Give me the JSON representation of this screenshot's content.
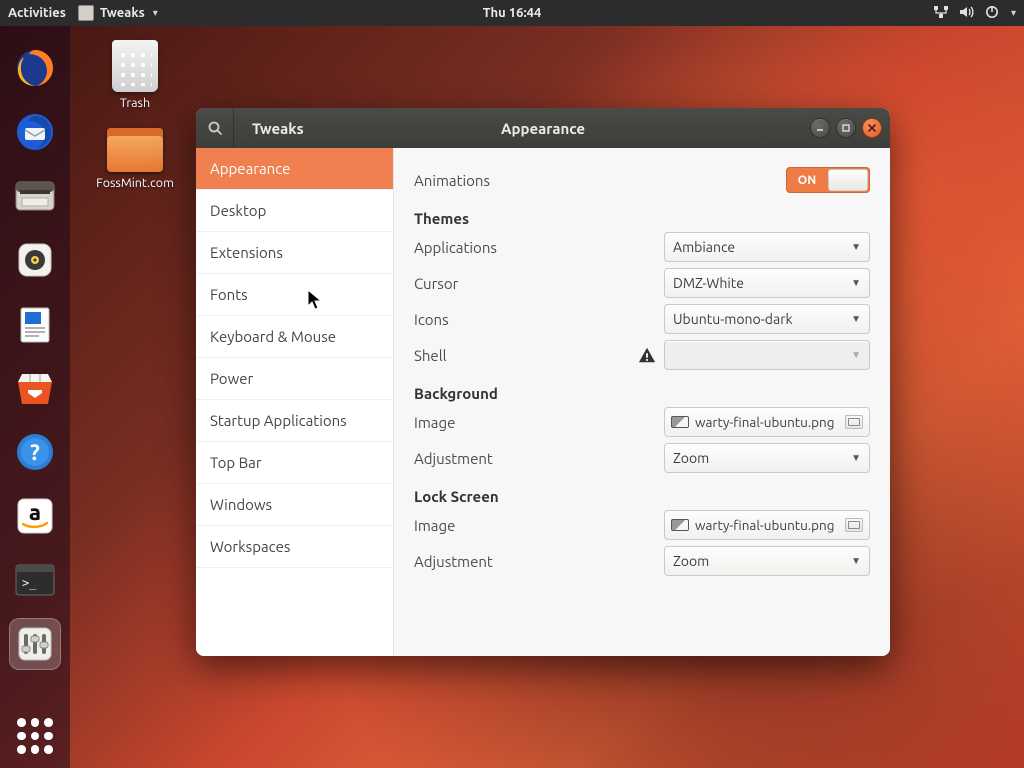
{
  "topbar": {
    "activities": "Activities",
    "app": "Tweaks",
    "clock": "Thu 16:44"
  },
  "desktop": {
    "trash": "Trash",
    "folder": "FossMint.com"
  },
  "window": {
    "title": "Tweaks",
    "header": "Appearance"
  },
  "sidebar": {
    "items": [
      "Appearance",
      "Desktop",
      "Extensions",
      "Fonts",
      "Keyboard & Mouse",
      "Power",
      "Startup Applications",
      "Top Bar",
      "Windows",
      "Workspaces"
    ],
    "selected": 0
  },
  "content": {
    "animations_label": "Animations",
    "switch_on": "ON",
    "themes_heading": "Themes",
    "applications_label": "Applications",
    "applications_value": "Ambiance",
    "cursor_label": "Cursor",
    "cursor_value": "DMZ-White",
    "icons_label": "Icons",
    "icons_value": "Ubuntu-mono-dark",
    "shell_label": "Shell",
    "shell_value": "",
    "background_heading": "Background",
    "bg_image_label": "Image",
    "bg_image_value": "warty-final-ubuntu.png",
    "bg_adjust_label": "Adjustment",
    "bg_adjust_value": "Zoom",
    "lock_heading": "Lock Screen",
    "lock_image_label": "Image",
    "lock_image_value": "warty-final-ubuntu.png",
    "lock_adjust_label": "Adjustment",
    "lock_adjust_value": "Zoom"
  }
}
